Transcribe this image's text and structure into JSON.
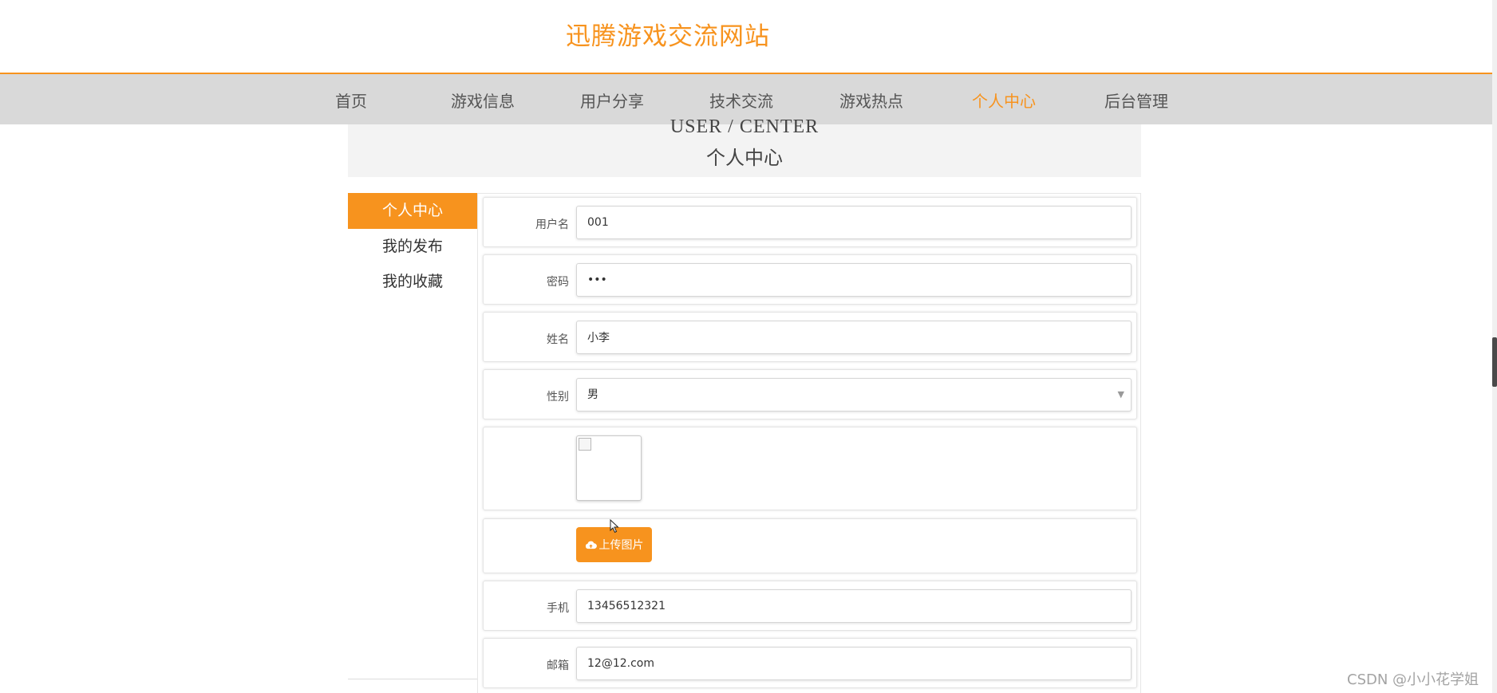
{
  "site": {
    "title": "迅腾游戏交流网站"
  },
  "nav": {
    "items": [
      {
        "label": "首页",
        "active": false
      },
      {
        "label": "游戏信息",
        "active": false
      },
      {
        "label": "用户分享",
        "active": false
      },
      {
        "label": "技术交流",
        "active": false
      },
      {
        "label": "游戏热点",
        "active": false
      },
      {
        "label": "个人中心",
        "active": true
      },
      {
        "label": "后台管理",
        "active": false
      }
    ]
  },
  "banner": {
    "en": "USER / CENTER",
    "zh": "个人中心"
  },
  "sidebar": {
    "items": [
      {
        "label": "个人中心",
        "active": true
      },
      {
        "label": "我的发布",
        "active": false
      },
      {
        "label": "我的收藏",
        "active": false
      }
    ]
  },
  "form": {
    "username": {
      "label": "用户名",
      "value": "001"
    },
    "password": {
      "label": "密码",
      "value": "•••"
    },
    "name": {
      "label": "姓名",
      "value": "小李"
    },
    "gender": {
      "label": "性别",
      "value": "男"
    },
    "upload": {
      "label": "上传图片"
    },
    "phone": {
      "label": "手机",
      "value": "13456512321"
    },
    "email": {
      "label": "邮箱",
      "value": "12@12.com"
    }
  },
  "watermark": "CSDN @小小花学姐",
  "colors": {
    "accent": "#f7931e",
    "nav_bg": "#d9d9d9",
    "banner_bg": "#f3f3f3"
  }
}
